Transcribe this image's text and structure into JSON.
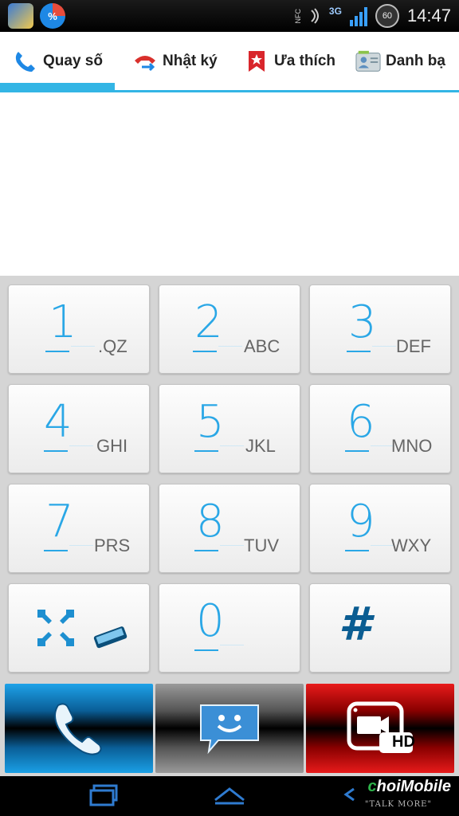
{
  "status_bar": {
    "left_icons": [
      "gallery-icon",
      "percent-pie-icon"
    ],
    "pie_label": "%",
    "network": "3G",
    "nfc_label": "NFC",
    "battery_level": "60",
    "time": "14:47"
  },
  "tabs": [
    {
      "label": "Quay số",
      "icon": "phone-icon",
      "active": true
    },
    {
      "label": "Nhật ký",
      "icon": "call-log-icon",
      "active": false
    },
    {
      "label": "Ưa thích",
      "icon": "bookmark-star-icon",
      "active": false
    },
    {
      "label": "Danh bạ",
      "icon": "contacts-card-icon",
      "active": false
    }
  ],
  "dialer_display": {
    "number": ""
  },
  "keys": [
    {
      "digit": "1",
      "letters": ".QZ"
    },
    {
      "digit": "2",
      "letters": "ABC"
    },
    {
      "digit": "3",
      "letters": "DEF"
    },
    {
      "digit": "4",
      "letters": "GHI"
    },
    {
      "digit": "5",
      "letters": "JKL"
    },
    {
      "digit": "6",
      "letters": "MNO"
    },
    {
      "digit": "7",
      "letters": "PRS"
    },
    {
      "digit": "8",
      "letters": "TUV"
    },
    {
      "digit": "9",
      "letters": "WXY"
    },
    {
      "digit": "",
      "letters": "",
      "icon": "collapse-keypad-icon"
    },
    {
      "digit": "0",
      "letters": ""
    },
    {
      "digit": "#",
      "letters": ""
    }
  ],
  "actions": {
    "call": {
      "icon": "phone-handset-icon",
      "color": "#1ea2e8"
    },
    "message": {
      "icon": "smiley-message-icon",
      "color": "#3b8fd6"
    },
    "video_call": {
      "icon": "video-call-hd-icon",
      "label": "HD",
      "color": "#e81b1b"
    }
  },
  "nav_bar": {
    "items": [
      "recent-apps-icon",
      "home-icon",
      "back-icon"
    ],
    "watermark": "choiMobile",
    "watermark_prefix": "c",
    "watermark_rest": "hoiMobile",
    "tagline": "\"TALK MORE\""
  },
  "colors": {
    "accent": "#33b5e5",
    "digit": "#2aa7e6"
  }
}
